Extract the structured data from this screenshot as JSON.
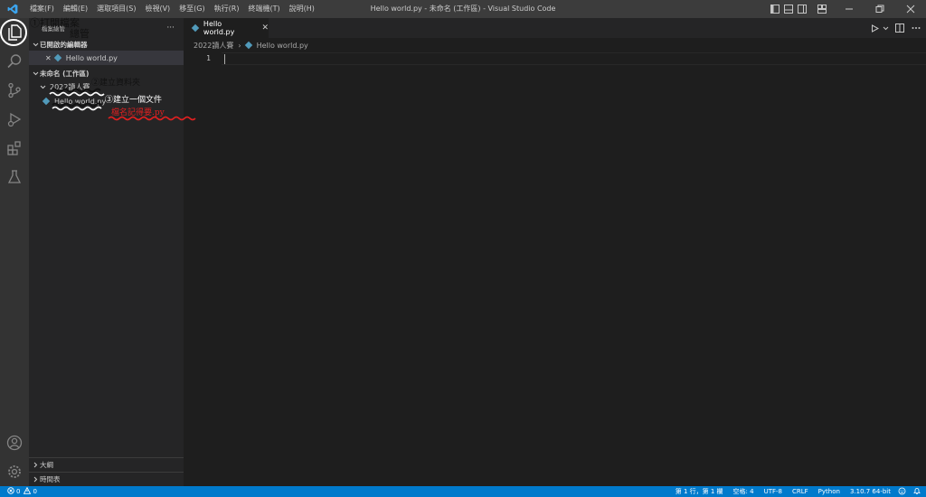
{
  "window_title": "Hello world.py - 未命名 (工作區) - Visual Studio Code",
  "menu": [
    "檔案(F)",
    "編輯(E)",
    "選取項目(S)",
    "檢視(V)",
    "移至(G)",
    "執行(R)",
    "終端機(T)",
    "說明(H)"
  ],
  "explorer": {
    "header": "檔案總管",
    "more": "···",
    "open_editors": {
      "title": "已開啟的編輯器",
      "items": [
        {
          "close": "✕",
          "name": "Hello world.py"
        }
      ]
    },
    "workspace": {
      "title": "未命名 (工作區)",
      "folder": "2022讀人賽",
      "file": "Hello world.py"
    },
    "outline": "大綱",
    "timeline": "時間表"
  },
  "editor": {
    "tab": {
      "name": "Hello world.py",
      "close": "✕"
    },
    "breadcrumb": {
      "folder": "2022讀人賽",
      "sep": "›",
      "file": "Hello world.py"
    },
    "line_numbers": [
      "1"
    ]
  },
  "statusbar": {
    "errors": "0",
    "warnings": "0",
    "position": "第 1 行，第 1 欄",
    "spaces": "空格: 4",
    "encoding": "UTF-8",
    "eol": "CRLF",
    "language": "Python",
    "interpreter": "3.10.7 64-bit"
  },
  "annotations": {
    "a1_line1": "①打開檔案",
    "a1_line2": "總管",
    "a2": "②建立資料夾",
    "a3": "③建立一個文件",
    "a4": "檔名記得要.py"
  },
  "colors": {
    "accent": "#007acc",
    "annotation_black": "#111111",
    "annotation_white": "#ffffff",
    "annotation_red": "#e02020"
  }
}
